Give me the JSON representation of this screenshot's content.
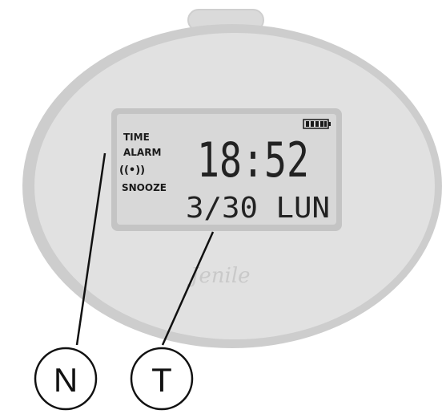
{
  "display": {
    "indicators": {
      "time": "TIME",
      "alarm": "ALARM",
      "sound_icon": "((•))",
      "snooze": "SNOOZE"
    },
    "clock": "18:52",
    "date": "3/30 LUN",
    "battery_icon": "battery-icon"
  },
  "brand": "Jenile",
  "callouts": [
    {
      "letter": "N"
    },
    {
      "letter": "T"
    }
  ],
  "colors": {
    "body": "#e2e2e2",
    "body_rim": "#c9c9c9",
    "lcd": "#d6d6d6",
    "lcd_border": "#b5b5b5",
    "ink": "#1a1a1a"
  }
}
